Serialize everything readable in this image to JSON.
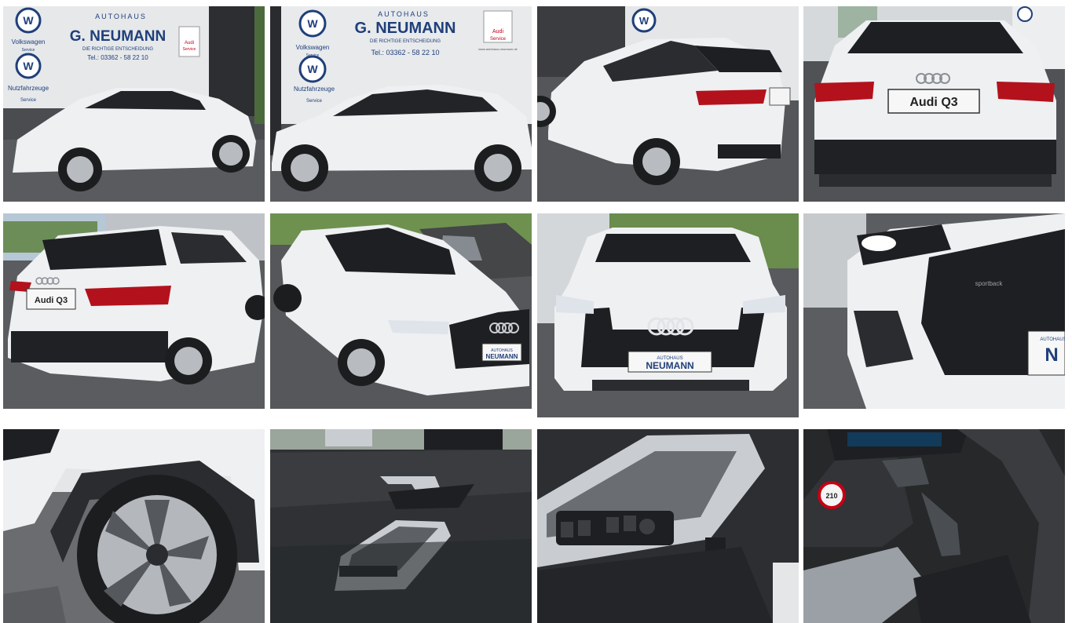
{
  "gallery": {
    "dealer": {
      "name": "G. NEUMANN",
      "name_styled": "G. NEUMANN",
      "prefix": "AUTOHAUS",
      "slogan": "DIE RICHTIGE ENTSCHEIDUNG",
      "phone": "Tel.: 03362 - 58 22 10",
      "vw_label": "Volkswagen",
      "vw_sub": "Service",
      "vwn_label": "Nutzfahrzeuge",
      "vwn_sub": "Service",
      "audi_label": "Audi",
      "audi_sub": "Service",
      "web": "www.autohaus-neumann.de"
    },
    "plates": {
      "model": "Audi Q3",
      "front_prefix": "AUTOHAUS",
      "front_name": "NEUMANN"
    },
    "model_badge": "sportback",
    "speed_sticker": "210",
    "colors": {
      "car_white": "#eef0f2",
      "asphalt": "#5d5f62",
      "wall": "#d9dce0",
      "grille": "#1d1f22",
      "tail_light": "#b3121c",
      "interior": "#2f3134",
      "trim_silver": "#c9ccd0"
    },
    "photos": [
      {
        "subject": "front-left side view"
      },
      {
        "subject": "left side view"
      },
      {
        "subject": "rear-right three-quarter view"
      },
      {
        "subject": "rear view"
      },
      {
        "subject": "rear-left three-quarter view"
      },
      {
        "subject": "front-left three-quarter view"
      },
      {
        "subject": "front view"
      },
      {
        "subject": "headlight and grille detail"
      },
      {
        "subject": "front wheel detail"
      },
      {
        "subject": "rear door panel"
      },
      {
        "subject": "front door panel switches"
      },
      {
        "subject": "steering column and dashboard"
      }
    ]
  }
}
